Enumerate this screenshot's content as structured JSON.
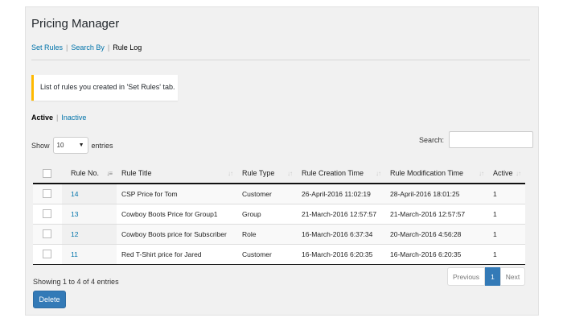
{
  "page": {
    "title": "Pricing Manager"
  },
  "subnav": {
    "set_rules": "Set Rules",
    "search_by": "Search By",
    "rule_log": "Rule Log",
    "separator": "|"
  },
  "notice": {
    "text": "List of rules you created in 'Set Rules' tab."
  },
  "status": {
    "active": "Active",
    "inactive": "Inactive",
    "separator": "|"
  },
  "length_menu": {
    "show": "Show",
    "value": "10",
    "entries": "entries"
  },
  "search": {
    "label": "Search:",
    "value": ""
  },
  "table": {
    "headers": [
      "Rule No.",
      "Rule Title",
      "Rule Type",
      "Rule Creation Time",
      "Rule Modification Time",
      "Active"
    ],
    "rows": [
      {
        "no": "14",
        "title": "CSP Price for Tom",
        "type": "Customer",
        "created": "26-April-2016 11:02:19",
        "modified": "28-April-2016 18:01:25",
        "active": "1"
      },
      {
        "no": "13",
        "title": "Cowboy Boots Price for Group1",
        "type": "Group",
        "created": "21-March-2016 12:57:57",
        "modified": "21-March-2016 12:57:57",
        "active": "1"
      },
      {
        "no": "12",
        "title": "Cowboy Boots price for Subscriber",
        "type": "Role",
        "created": "16-March-2016 6:37:34",
        "modified": "20-March-2016 4:56:28",
        "active": "1"
      },
      {
        "no": "11",
        "title": "Red T-Shirt price for Jared",
        "type": "Customer",
        "created": "16-March-2016 6:20:35",
        "modified": "16-March-2016 6:20:35",
        "active": "1"
      }
    ]
  },
  "info": {
    "text": "Showing 1 to 4 of 4 entries"
  },
  "pagination": {
    "previous": "Previous",
    "current": "1",
    "next": "Next"
  },
  "actions": {
    "delete": "Delete"
  },
  "colors": {
    "accent": "#337ab7",
    "link": "#0073aa",
    "notice_border": "#ffb900"
  }
}
